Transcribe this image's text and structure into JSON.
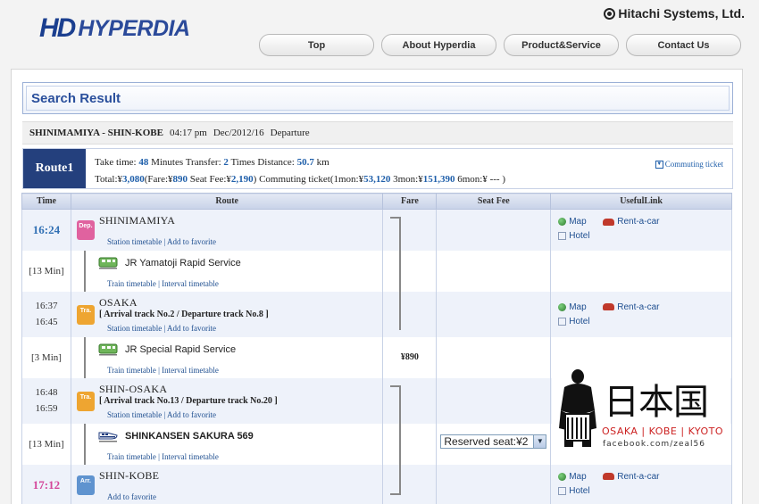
{
  "brand": {
    "mark": "HD",
    "name": "HYPERDIA",
    "corp": "Hitachi Systems, Ltd."
  },
  "nav": [
    "Top",
    "About Hyperdia",
    "Product&Service",
    "Contact Us"
  ],
  "search_title": "Search Result",
  "route_line": {
    "stations": "SHINIMAMIYA - SHIN-KOBE",
    "time": "04:17 pm",
    "date": "Dec/2012/16",
    "mode": "Departure"
  },
  "summary": {
    "route_label": "Route1",
    "take_time_label": "Take time:",
    "take_time_value": "48",
    "minutes_label": "Minutes",
    "transfer_label": "Transfer:",
    "transfer_value": "2",
    "times_label": "Times",
    "distance_label": "Distance:",
    "distance_value": "50.7",
    "km_label": "km",
    "total_label": "Total:¥",
    "total_value": "3,080",
    "fare_label": "(Fare:¥",
    "fare_value": "890",
    "seat_label": "Seat Fee:¥",
    "seat_value": "2,190",
    "commute_label": ") Commuting ticket(1mon:¥",
    "mon1": "53,120",
    "mon3_label": "3mon:¥",
    "mon3": "151,390",
    "mon6_label": "6mon:¥ --- )",
    "commute_link": "Commuting ticket"
  },
  "table": {
    "headers": [
      "Time",
      "Route",
      "Fare",
      "Seat Fee",
      "UsefulLink"
    ],
    "rows": [
      {
        "time": "16:24",
        "badge": "Dep.",
        "name": "SHINIMAMIYA",
        "sub": "Station timetable | Add to favorite"
      },
      {
        "time": "[13 Min]",
        "train": "JR Yamatoji Rapid Service",
        "sub": "Train timetable | Interval timetable"
      },
      {
        "time1": "16:37",
        "time2": "16:45",
        "badge": "Tra.",
        "name": "OSAKA",
        "track": "[ Arrival track No.2 / Departure track No.8 ]",
        "sub": "Station timetable | Add to favorite"
      },
      {
        "time": "[3 Min]",
        "train": "JR Special Rapid Service",
        "sub": "Train timetable | Interval timetable",
        "fare": "¥890"
      },
      {
        "time1": "16:48",
        "time2": "16:59",
        "badge": "Tra.",
        "name": "SHIN-OSAKA",
        "track": "[ Arrival track No.13 / Departure track No.20 ]",
        "sub": "Station timetable | Add to favorite"
      },
      {
        "time": "[13 Min]",
        "train": "SHINKANSEN SAKURA 569",
        "sub": "Train timetable | Interval timetable",
        "seat_select": "Reserved seat:¥2"
      },
      {
        "time": "17:12",
        "badge": "Arr.",
        "name": "SHIN-KOBE",
        "sub": "Add to favorite"
      }
    ]
  },
  "links": {
    "map": "Map",
    "car": "Rent-a-car",
    "hotel": "Hotel"
  },
  "watermark": {
    "kanji": "日本国",
    "cities": "OSAKA | KOBE | KYOTO",
    "fb": "facebook.com/zeal56"
  }
}
